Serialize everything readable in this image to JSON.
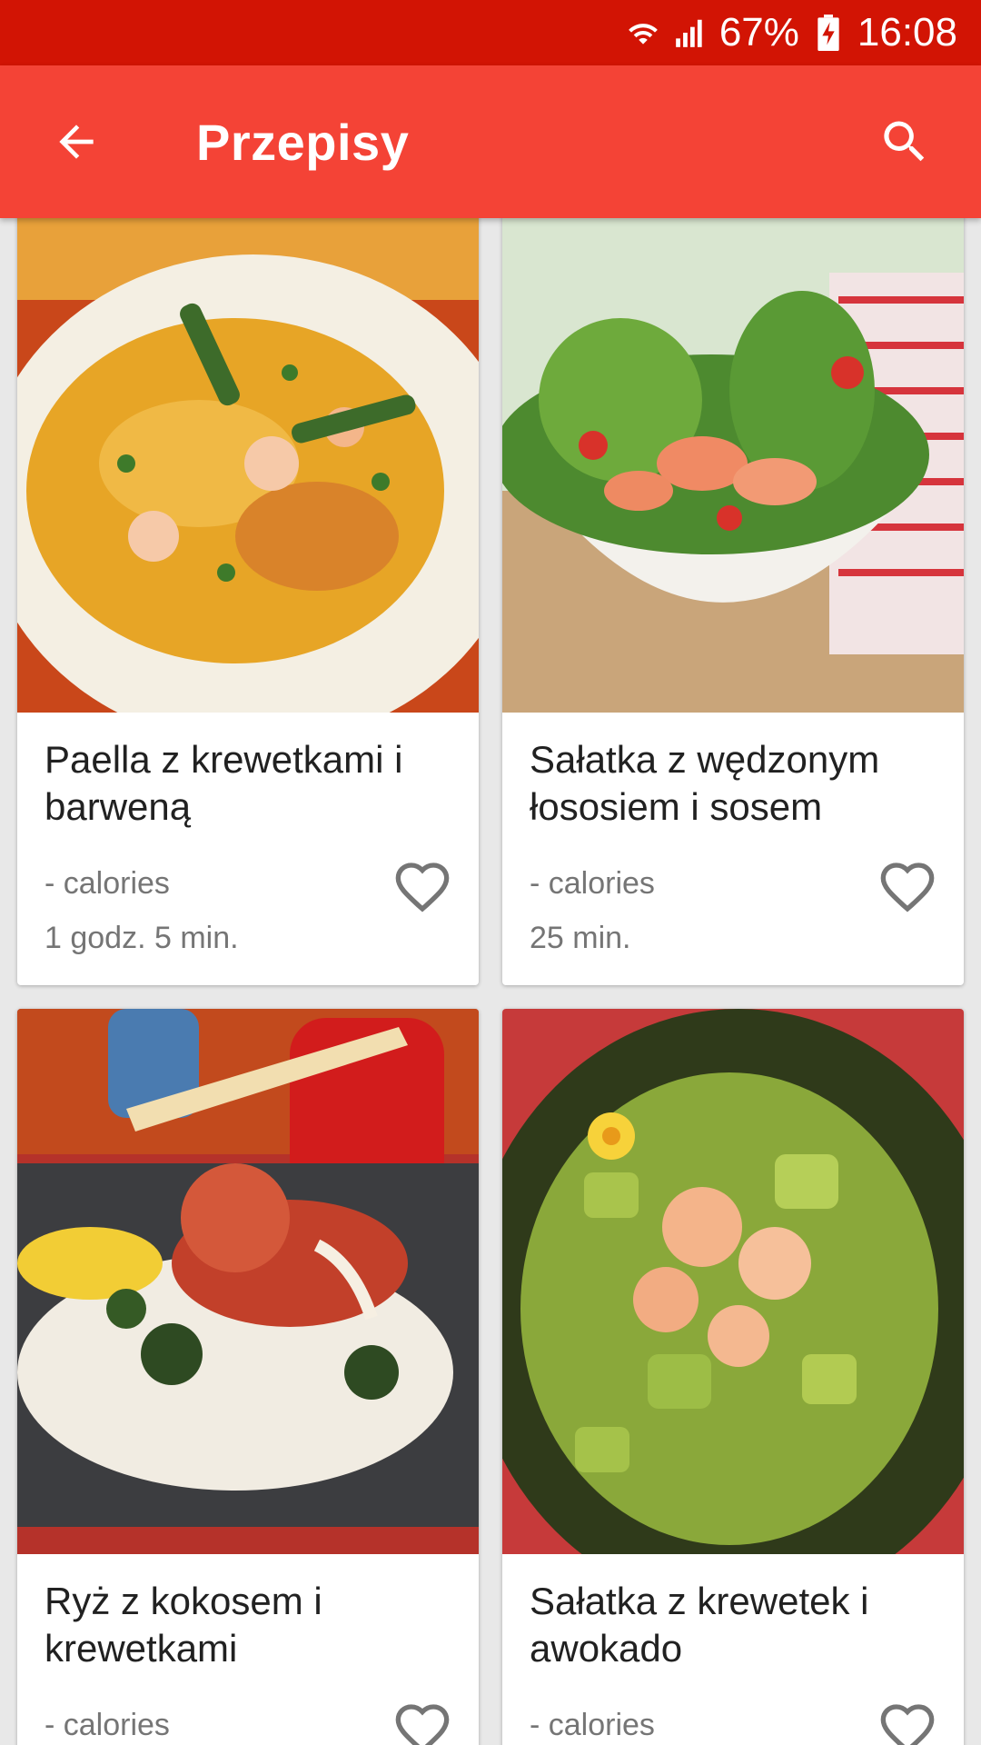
{
  "status_bar": {
    "battery": "67%",
    "time": "16:08",
    "icons": [
      "wifi-icon",
      "signal-icon",
      "battery-charging-icon"
    ]
  },
  "app_bar": {
    "title": "Przepisy",
    "back_icon": "arrow-back-icon",
    "search_icon": "search-icon"
  },
  "colors": {
    "status_bar": "#d21404",
    "app_bar": "#f44336",
    "background": "#e8e8e8"
  },
  "recipes": [
    {
      "name": "Paella z krewetkami i barweną",
      "calories": "- calories",
      "time": "1 godz. 5 min.",
      "favorite_icon": "heart-outline-icon"
    },
    {
      "name": "Sałatka z wędzonym łososiem i sosem",
      "calories": "- calories",
      "time": "25 min.",
      "favorite_icon": "heart-outline-icon"
    },
    {
      "name": "Ryż z kokosem i krewetkami",
      "calories": "- calories",
      "time": "",
      "favorite_icon": "heart-outline-icon"
    },
    {
      "name": "Sałatka z krewetek i awokado",
      "calories": "- calories",
      "time": "",
      "favorite_icon": "heart-outline-icon"
    }
  ]
}
